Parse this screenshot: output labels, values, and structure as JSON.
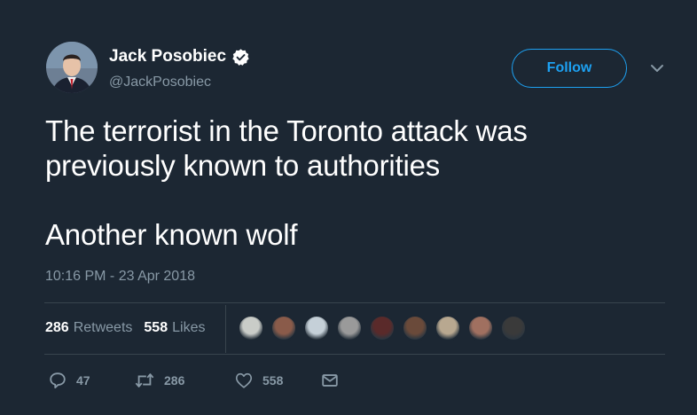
{
  "tweet": {
    "author_name": "Jack Posobiec",
    "handle": "@JackPosobiec",
    "follow_label": "Follow",
    "text": "The terrorist in the Toronto attack was\npreviously known to authorities\n\nAnother known wolf",
    "timestamp": "10:16 PM - 23 Apr 2018"
  },
  "stats": {
    "retweets_count": "286",
    "retweets_label": "Retweets",
    "likes_count": "558",
    "likes_label": "Likes"
  },
  "actions": {
    "reply_count": "47",
    "retweet_count": "286",
    "like_count": "558"
  },
  "liker_avatars": [
    {
      "name": "liker-avatar-1",
      "color": "#c9ccc8"
    },
    {
      "name": "liker-avatar-2",
      "color": "#8a5b4a"
    },
    {
      "name": "liker-avatar-3",
      "color": "#c5d0d8"
    },
    {
      "name": "liker-avatar-4",
      "color": "#9a9a9a"
    },
    {
      "name": "liker-avatar-5",
      "color": "#5a2a2a"
    },
    {
      "name": "liker-avatar-6",
      "color": "#6a4a3a"
    },
    {
      "name": "liker-avatar-7",
      "color": "#b8a890"
    },
    {
      "name": "liker-avatar-8",
      "color": "#a07060"
    },
    {
      "name": "liker-avatar-9",
      "color": "#3a3a3a"
    }
  ],
  "colors": {
    "background": "#1c2733",
    "accent": "#1da1f2",
    "secondary_text": "#8899a6",
    "divider": "#38444d"
  }
}
